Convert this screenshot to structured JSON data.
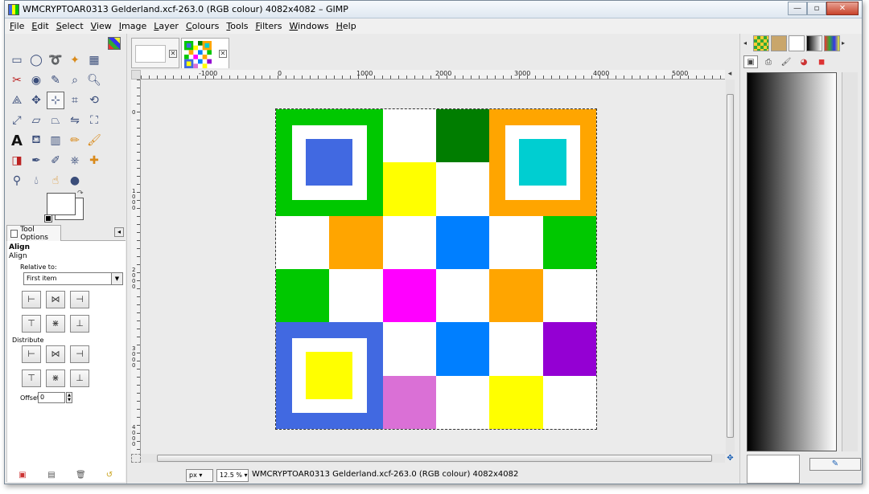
{
  "window": {
    "title": "WMCRYPTOAR0313 Gelderland.xcf-263.0 (RGB colour) 4082x4082 – GIMP",
    "minimize": "—",
    "maximize": "▫",
    "close": "✕"
  },
  "menu": [
    "File",
    "Edit",
    "Select",
    "View",
    "Image",
    "Layer",
    "Colours",
    "Tools",
    "Filters",
    "Windows",
    "Help"
  ],
  "tools": [
    "rect-select",
    "ellipse-select",
    "free-select",
    "fuzzy-select",
    "by-color-select",
    "scissors-select",
    "foreground-select",
    "paths",
    "color-picker",
    "zoom",
    "measure",
    "move",
    "align",
    "crop",
    "rotate",
    "scale",
    "shear",
    "perspective",
    "flip",
    "cage",
    "text",
    "bucket-fill",
    "blend",
    "pencil",
    "paintbrush",
    "eraser",
    "airbrush",
    "ink",
    "clone",
    "heal",
    "perspective-clone",
    "blur",
    "smudge",
    "dodge-burn"
  ],
  "tool_options": {
    "tab_label": "Tool Options",
    "title": "Align",
    "subtitle": "Align",
    "relative_to_label": "Relative to:",
    "relative_to_value": "First item",
    "distribute_label": "Distribute",
    "offset_label": "Offset:",
    "offset_value": "0"
  },
  "ruler": {
    "h_labels": [
      "-1000",
      "0",
      "1000",
      "2000",
      "3000",
      "4000",
      "5000"
    ],
    "v_labels": [
      "0",
      "1000",
      "2000",
      "3000",
      "4000"
    ]
  },
  "image": {
    "grid": [
      [
        "#00c800",
        "#ffffff",
        "#007d00",
        "#ffa500"
      ],
      [
        "#ffffff",
        "#ffff00",
        "#ffffff",
        "#ffa500"
      ]
    ],
    "cells": [
      {
        "r": 0,
        "c": 0,
        "w": 2,
        "h": 2,
        "color": "#00c800",
        "inner": "#ffffff",
        "core": "#4169e1"
      },
      {
        "r": 0,
        "c": 2,
        "w": 1,
        "h": 1,
        "color": "#ffffff"
      },
      {
        "r": 0,
        "c": 3,
        "w": 1,
        "h": 1,
        "color": "#007d00"
      },
      {
        "r": 0,
        "c": 4,
        "w": 2,
        "h": 2,
        "color": "#ffa500",
        "inner": "#ffffff",
        "core": "#00ced1"
      },
      {
        "r": 1,
        "c": 2,
        "w": 1,
        "h": 1,
        "color": "#ffff00"
      },
      {
        "r": 1,
        "c": 3,
        "w": 1,
        "h": 1,
        "color": "#ffffff"
      },
      {
        "r": 2,
        "c": 0,
        "w": 1,
        "h": 1,
        "color": "#ffffff"
      },
      {
        "r": 2,
        "c": 1,
        "w": 1,
        "h": 1,
        "color": "#ffa500"
      },
      {
        "r": 2,
        "c": 2,
        "w": 1,
        "h": 1,
        "color": "#ffffff"
      },
      {
        "r": 2,
        "c": 3,
        "w": 1,
        "h": 1,
        "color": "#007fff"
      },
      {
        "r": 2,
        "c": 4,
        "w": 1,
        "h": 1,
        "color": "#ffffff"
      },
      {
        "r": 2,
        "c": 5,
        "w": 1,
        "h": 1,
        "color": "#00c800"
      },
      {
        "r": 3,
        "c": 0,
        "w": 1,
        "h": 1,
        "color": "#00c800"
      },
      {
        "r": 3,
        "c": 1,
        "w": 1,
        "h": 1,
        "color": "#ffffff"
      },
      {
        "r": 3,
        "c": 2,
        "w": 1,
        "h": 1,
        "color": "#ff00ff"
      },
      {
        "r": 3,
        "c": 3,
        "w": 1,
        "h": 1,
        "color": "#ffffff"
      },
      {
        "r": 3,
        "c": 4,
        "w": 1,
        "h": 1,
        "color": "#ffa500"
      },
      {
        "r": 3,
        "c": 5,
        "w": 1,
        "h": 1,
        "color": "#ffffff"
      },
      {
        "r": 4,
        "c": 0,
        "w": 2,
        "h": 2,
        "color": "#4169e1",
        "inner": "#ffffff",
        "core": "#ffff00"
      },
      {
        "r": 4,
        "c": 2,
        "w": 1,
        "h": 1,
        "color": "#ffffff"
      },
      {
        "r": 4,
        "c": 3,
        "w": 1,
        "h": 1,
        "color": "#007fff"
      },
      {
        "r": 4,
        "c": 4,
        "w": 1,
        "h": 1,
        "color": "#ffffff"
      },
      {
        "r": 4,
        "c": 5,
        "w": 1,
        "h": 1,
        "color": "#9400d3"
      },
      {
        "r": 5,
        "c": 2,
        "w": 1,
        "h": 1,
        "color": "#da70d6"
      },
      {
        "r": 5,
        "c": 3,
        "w": 1,
        "h": 1,
        "color": "#ffffff"
      },
      {
        "r": 5,
        "c": 4,
        "w": 1,
        "h": 1,
        "color": "#ffff00"
      },
      {
        "r": 5,
        "c": 5,
        "w": 1,
        "h": 1,
        "color": "#ffffff"
      }
    ]
  },
  "status": {
    "unit": "px",
    "zoom": "12.5 %",
    "text": "WMCRYPTOAR0313 Gelderland.xcf-263.0 (RGB colour) 4082x4082"
  }
}
